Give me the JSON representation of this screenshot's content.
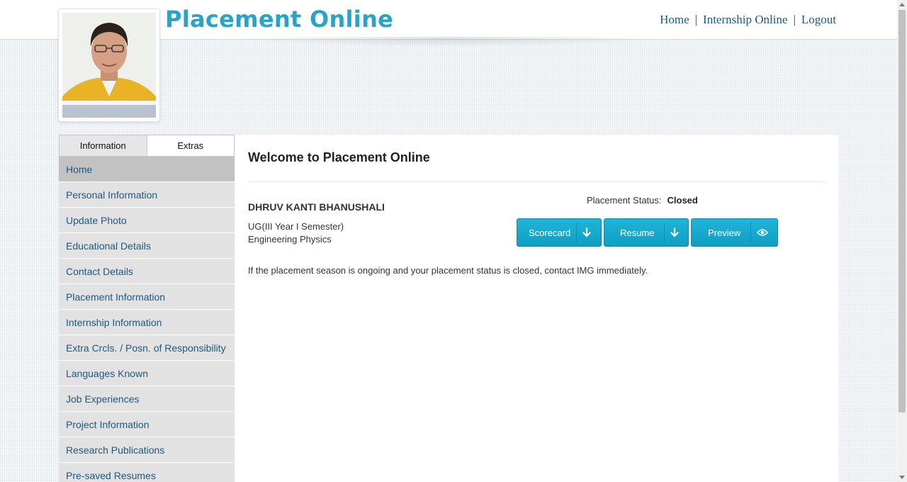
{
  "site": {
    "title": "Placement Online"
  },
  "topnav": {
    "home": "Home",
    "internship": "Internship Online",
    "logout": "Logout",
    "separator": "|"
  },
  "sidebar": {
    "tabs": [
      {
        "label": "Information",
        "state": "inactive"
      },
      {
        "label": "Extras",
        "state": "active"
      }
    ],
    "items": [
      {
        "label": "Home"
      },
      {
        "label": "Personal Information"
      },
      {
        "label": "Update Photo"
      },
      {
        "label": "Educational Details"
      },
      {
        "label": "Contact Details"
      },
      {
        "label": "Placement Information"
      },
      {
        "label": "Internship Information"
      },
      {
        "label": "Extra Crcls. / Posn. of Responsibility"
      },
      {
        "label": "Languages Known"
      },
      {
        "label": "Job Experiences"
      },
      {
        "label": "Project Information"
      },
      {
        "label": "Research Publications"
      },
      {
        "label": "Pre-saved Resumes"
      }
    ]
  },
  "main": {
    "heading": "Welcome to Placement Online",
    "student": {
      "name": "DHRUV KANTI BHANUSHALI",
      "program": "UG(III Year I Semester)",
      "branch": "Engineering Physics"
    },
    "status": {
      "label": "Placement Status:",
      "value": "Closed"
    },
    "buttons": {
      "scorecard": "Scorecard",
      "resume": "Resume",
      "preview": "Preview"
    },
    "note": "If the placement season is ongoing and your placement status is closed, contact IMG immediately."
  },
  "colors": {
    "brand": "#2aa3c9",
    "button": "#12a6ca",
    "link": "#1a5a84"
  }
}
